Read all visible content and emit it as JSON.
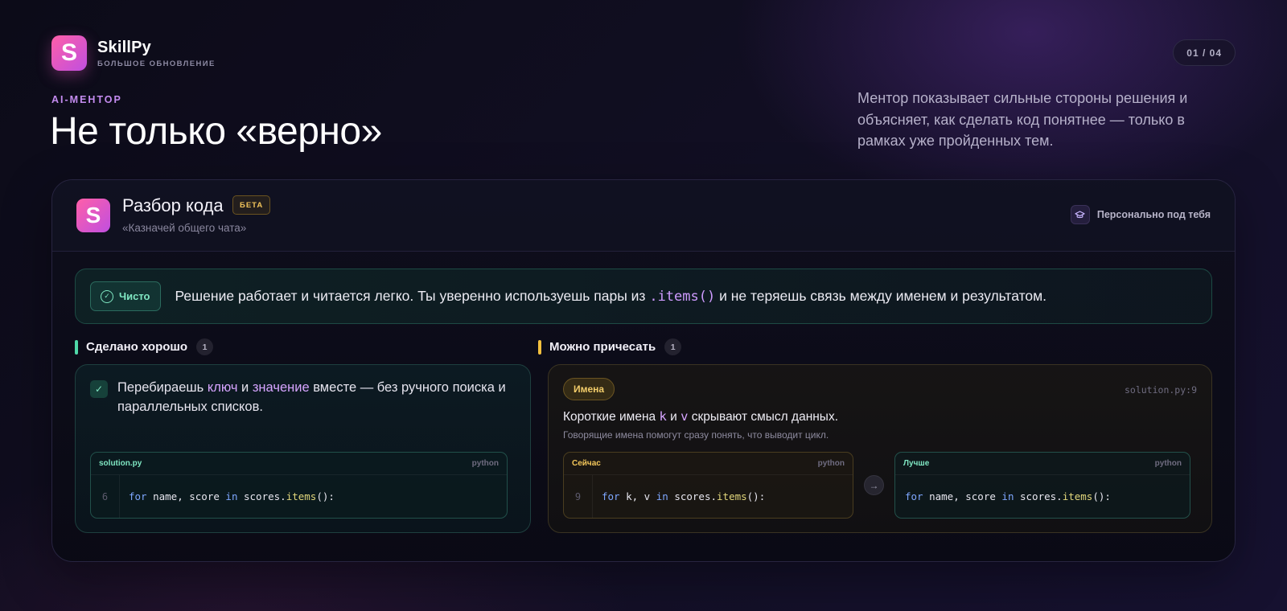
{
  "brand": {
    "logo_letter": "S",
    "name": "SkillPy",
    "subtitle": "БОЛЬШОЕ ОБНОВЛЕНИЕ"
  },
  "pager": "01 / 04",
  "hero": {
    "eyebrow": "AI-МЕНТОР",
    "title": "Не только «верно»",
    "lead": "Ментор показывает сильные стороны решения и объясняет, как сделать код понятнее — только в рамках уже пройденных тем."
  },
  "card": {
    "logo_letter": "S",
    "title": "Разбор кода",
    "beta": "БЕТА",
    "subtitle": "«Казначей общего чата»",
    "persona": {
      "icon": "graduation-cap-icon",
      "label": "Персонально под тебя"
    },
    "verdict": {
      "badge": "Чисто",
      "text_before": "Решение работает и читается легко. Ты уверенно используешь пары из ",
      "code": ".items()",
      "text_after": " и не теряешь связь между именем и результатом."
    },
    "good": {
      "header": "Сделано хорошо",
      "count": "1",
      "item": {
        "t1": "Перебираешь ",
        "k1": "ключ",
        "t2": " и ",
        "k2": "значение",
        "t3": " вместе — без ручного поиска и параллельных списков."
      },
      "code": {
        "file": "solution.py",
        "lang": "python",
        "line": "6",
        "tokens": [
          "for",
          " name, score ",
          "in",
          " scores.",
          "items",
          "():"
        ]
      }
    },
    "improve": {
      "header": "Можно причесать",
      "count": "1",
      "tag": "Имена",
      "location": "solution.py:9",
      "title": {
        "t1": "Короткие имена ",
        "k1": "k",
        "t2": " и ",
        "k2": "v",
        "t3": " скрывают смысл данных."
      },
      "subtitle": "Говорящие имена помогут сразу понять, что выводит цикл.",
      "now": {
        "title": "Сейчас",
        "lang": "python",
        "line": "9",
        "tokens": [
          "for",
          " k, v ",
          "in",
          " scores.",
          "items",
          "():"
        ]
      },
      "better": {
        "title": "Лучше",
        "lang": "python",
        "tokens": [
          "for",
          " name, score ",
          "in",
          " scores.",
          "items",
          "():"
        ]
      }
    }
  },
  "colors": {
    "accent_green": "#7fe6c2",
    "accent_yellow": "#f3c65a",
    "accent_purple": "#c48cf0",
    "logo_gradient_start": "#ff5fa8",
    "logo_gradient_end": "#c04fe0"
  }
}
